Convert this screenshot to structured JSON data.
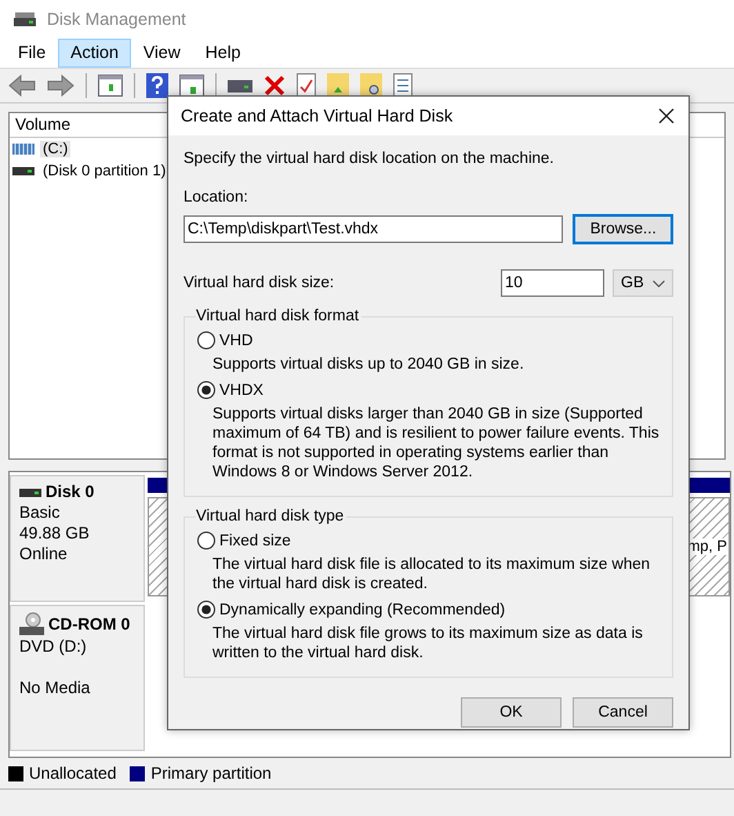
{
  "window": {
    "title": "Disk Management"
  },
  "menu": [
    {
      "label": "File",
      "selected": false
    },
    {
      "label": "Action",
      "selected": true
    },
    {
      "label": "View",
      "selected": false
    },
    {
      "label": "Help",
      "selected": false
    }
  ],
  "volume_list": {
    "columns": [
      "Volume"
    ],
    "rows": [
      {
        "name": "(C:)",
        "selected": true,
        "kind": "striped"
      },
      {
        "name": "(Disk 0 partition 1)",
        "selected": false,
        "kind": "plain"
      }
    ]
  },
  "disks": [
    {
      "kind": "disk",
      "name": "Disk 0",
      "lines": [
        "Basic",
        "49.88 GB",
        "Online"
      ],
      "partition_text": "mp, P"
    },
    {
      "kind": "cdrom",
      "name": "CD-ROM 0",
      "lines": [
        "DVD (D:)",
        "No Media"
      ]
    }
  ],
  "legend": [
    {
      "label": "Unallocated",
      "color": "#000000"
    },
    {
      "label": "Primary partition",
      "color": "#000080"
    }
  ],
  "dialog": {
    "title": "Create and Attach Virtual Hard Disk",
    "instruction": "Specify the virtual hard disk location on the machine.",
    "location_label": "Location:",
    "location_value": "C:\\Temp\\diskpart\\Test.vhdx",
    "browse_button": "Browse...",
    "size_label": "Virtual hard disk size:",
    "size_value": "10",
    "size_unit": "GB",
    "format_group": {
      "title": "Virtual hard disk format",
      "options": [
        {
          "label": "VHD",
          "description": "Supports virtual disks up to 2040 GB in size.",
          "selected": false
        },
        {
          "label": "VHDX",
          "description": "Supports virtual disks larger than 2040 GB in size (Supported maximum of 64 TB) and is resilient to power failure events. This format is not supported in operating systems earlier than Windows 8 or Windows Server 2012.",
          "selected": true
        }
      ]
    },
    "type_group": {
      "title": "Virtual hard disk type",
      "options": [
        {
          "label": "Fixed size",
          "description": "The virtual hard disk file is allocated to its maximum size when the virtual hard disk is created.",
          "selected": false
        },
        {
          "label": "Dynamically expanding (Recommended)",
          "description": "The virtual hard disk file grows to its maximum size as data is written to the virtual hard disk.",
          "selected": true
        }
      ]
    },
    "buttons": [
      "OK",
      "Cancel"
    ]
  }
}
